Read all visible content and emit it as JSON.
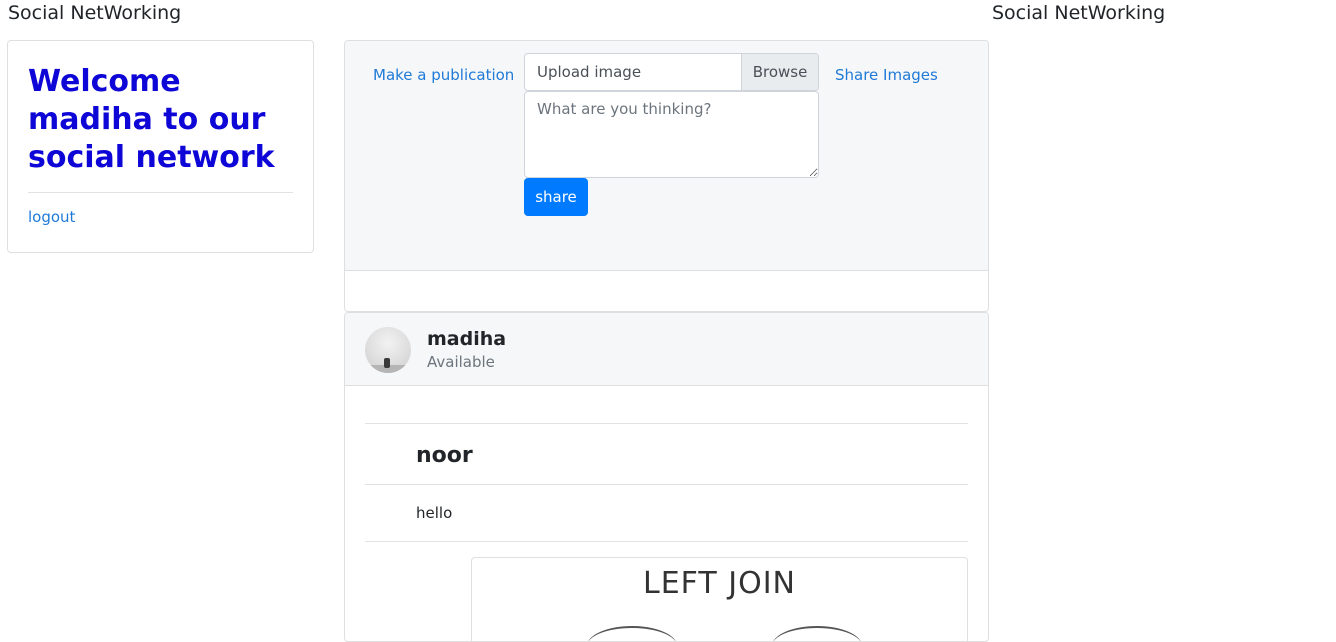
{
  "brand": {
    "left": "Social NetWorking",
    "right": "Social NetWorking"
  },
  "welcome": {
    "title": "Welcome madiha to our social network",
    "logout_label": "logout"
  },
  "publication": {
    "make_label": "Make a publication",
    "upload_label": "Upload image",
    "browse_label": "Browse",
    "share_images_label": "Share Images",
    "thinking_placeholder": "What are you thinking?",
    "share_label": "share"
  },
  "post": {
    "username": "madiha",
    "status": "Available",
    "comment_author": "noor",
    "comment_text": "hello",
    "image_caption": "LEFT JOIN"
  },
  "colors": {
    "welcome_title": "#0d06d6",
    "link": "#1f7ad8",
    "primary_button": "#007bff",
    "panel_bg": "#f6f7f8"
  }
}
